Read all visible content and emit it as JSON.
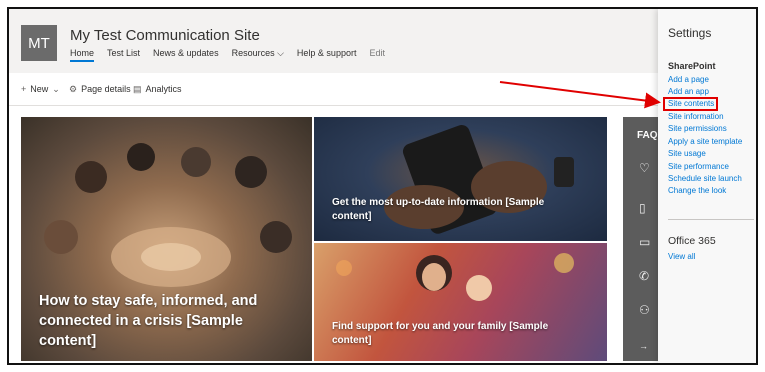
{
  "site": {
    "logo_text": "MT",
    "title": "My Test Communication Site",
    "nav": [
      "Home",
      "Test List",
      "News & updates",
      "Resources ⌵",
      "Help & support",
      "Edit"
    ]
  },
  "commands": {
    "new_label": "New",
    "page_details_label": "Page details",
    "analytics_label": "Analytics"
  },
  "hero": {
    "tile1_caption": "How to stay safe, informed, and connected in a crisis [Sample content]",
    "tile2_caption": "Get the most up-to-date information [Sample content]",
    "tile3_caption": "Find support for you and your family [Sample content]"
  },
  "faq": {
    "title": "FAQ"
  },
  "settings": {
    "title": "Settings",
    "sharepoint_heading": "SharePoint",
    "links": [
      "Add a page",
      "Add an app",
      "Site contents",
      "Site information",
      "Site permissions",
      "Apply a site template",
      "Site usage",
      "Site performance",
      "Schedule site launch",
      "Change the look"
    ],
    "office_heading": "Office 365",
    "office_links": [
      "View all"
    ]
  },
  "colors": {
    "accent": "#0078d4",
    "highlight": "#e00000",
    "logo_bg": "#6b6b6b"
  },
  "icons": {
    "plus": "plus-icon",
    "gear": "gear-icon",
    "analytics": "analytics-icon"
  }
}
